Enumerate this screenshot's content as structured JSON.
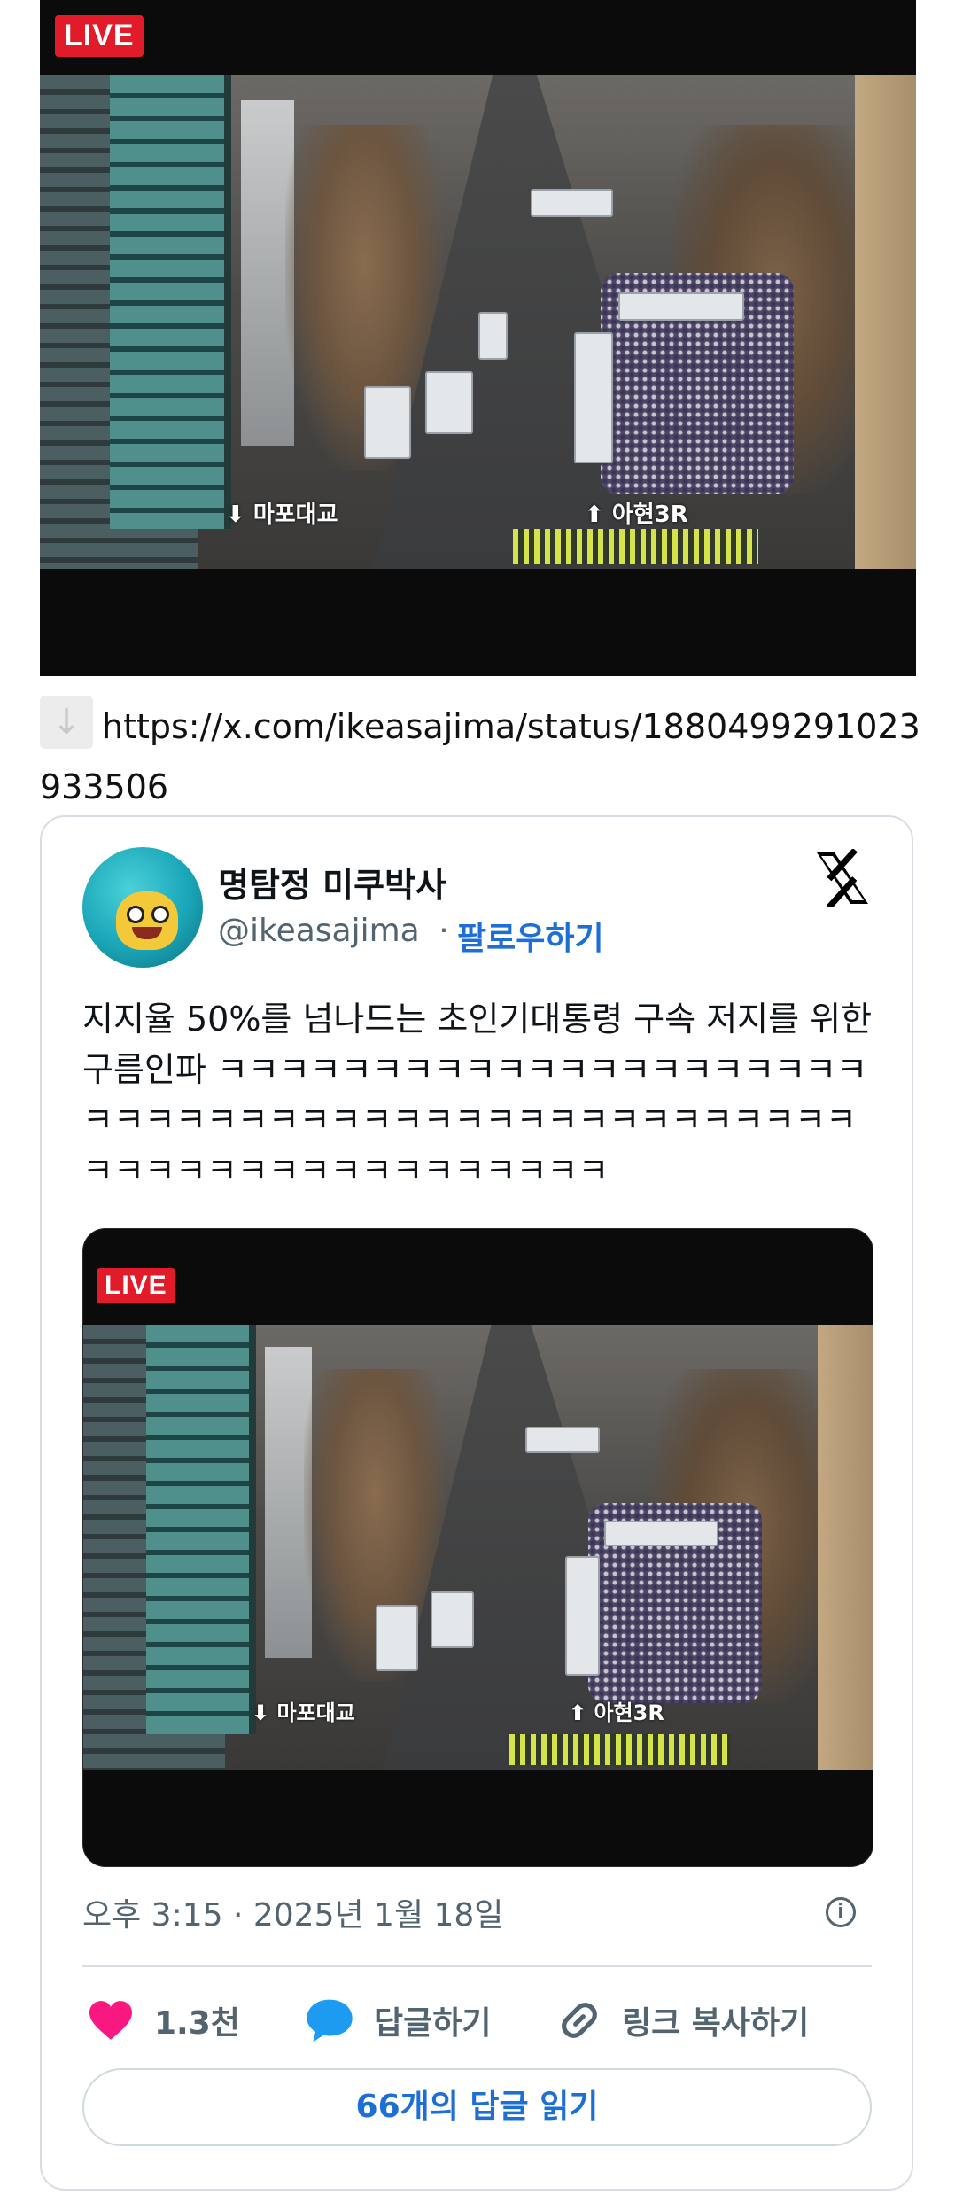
{
  "video": {
    "badge": "LIVE",
    "label_left": "⬇ 마포대교",
    "label_right": "⬆ 아현3R"
  },
  "link": {
    "icon": "down-arrow-icon",
    "url": "https://x.com/ikeasajima/status/1880499291023933506"
  },
  "tweet": {
    "display_name": "명탐정 미쿠박사",
    "handle": "@ikeasajima",
    "separator": "·",
    "follow_label": "팔로우하기",
    "text": "지지율 50%를 넘나드는 초인기대통령 구속 저지를 위한 구름인파 ㅋㅋㅋㅋㅋㅋㅋㅋㅋㅋㅋㅋㅋㅋㅋㅋㅋㅋㅋㅋㅋㅋㅋㅋㅋㅋㅋㅋㅋㅋㅋㅋㅋㅋㅋㅋㅋㅋㅋㅋㅋㅋㅋㅋㅋㅋㅋㅋㅋㅋㅋㅋㅋㅋㅋㅋㅋㅋㅋㅋㅋㅋㅋ",
    "timestamp": "오후 3:15 · 2025년 1월 18일",
    "likes": "1.3천",
    "reply_label": "답글하기",
    "copy_link_label": "링크 복사하기",
    "read_replies_label": "66개의 답글 읽기",
    "info_glyph": "i"
  },
  "colors": {
    "like": "#f91880",
    "reply": "#1d9bf0",
    "link_blue": "#1d6fd6",
    "live_red": "#e21b2b"
  },
  "icons": [
    "x-logo-icon",
    "heart-icon",
    "speech-bubble-icon",
    "link-icon",
    "info-icon"
  ]
}
